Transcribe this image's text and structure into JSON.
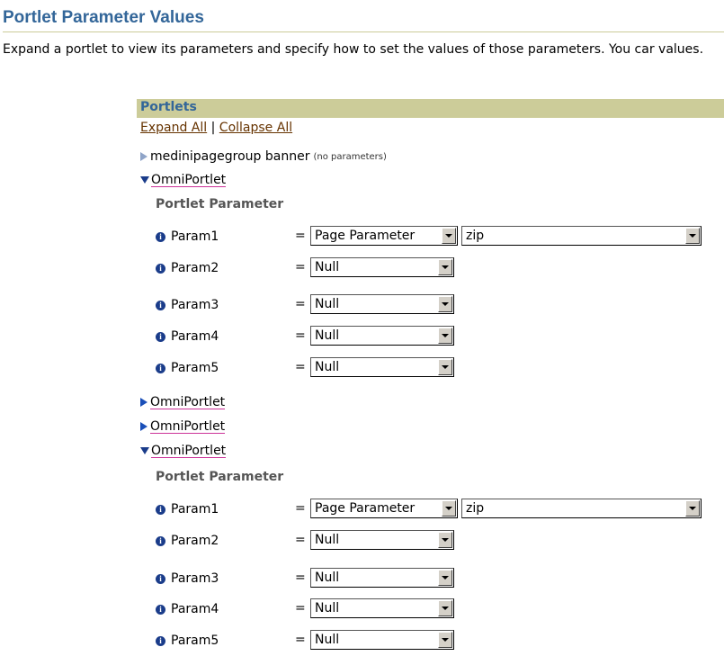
{
  "page": {
    "title": "Portlet Parameter Values",
    "description": "Expand a portlet to view its parameters and specify how to set the values of those parameters. You car values."
  },
  "portlets": {
    "header": "Portlets",
    "expand_all": "Expand All",
    "separator": "|",
    "collapse_all": "Collapse All",
    "items": [
      {
        "label": "medinipagegroup banner",
        "note": "(no parameters)"
      },
      {
        "label": "OmniPortlet"
      },
      {
        "label": "OmniPortlet"
      },
      {
        "label": "OmniPortlet"
      },
      {
        "label": "OmniPortlet"
      }
    ],
    "param_header": "Portlet Parameter",
    "equals": "=",
    "groups": [
      {
        "params": [
          {
            "name": "Param1",
            "type": "Page Parameter",
            "value": "zip"
          },
          {
            "name": "Param2",
            "type": "Null"
          },
          {
            "name": "Param3",
            "type": "Null"
          },
          {
            "name": "Param4",
            "type": "Null"
          },
          {
            "name": "Param5",
            "type": "Null"
          }
        ]
      },
      {
        "params": [
          {
            "name": "Param1",
            "type": "Page Parameter",
            "value": "zip"
          },
          {
            "name": "Param2",
            "type": "Null"
          },
          {
            "name": "Param3",
            "type": "Null"
          },
          {
            "name": "Param4",
            "type": "Null"
          },
          {
            "name": "Param5",
            "type": "Null"
          }
        ]
      }
    ]
  },
  "icons": {
    "collapsed_light": "triangle-right-icon",
    "collapsed": "triangle-right-icon",
    "expanded": "triangle-down-icon",
    "info": "info-icon"
  },
  "colors": {
    "title": "#336699",
    "header_bg": "#cccc99",
    "link": "#663300"
  }
}
